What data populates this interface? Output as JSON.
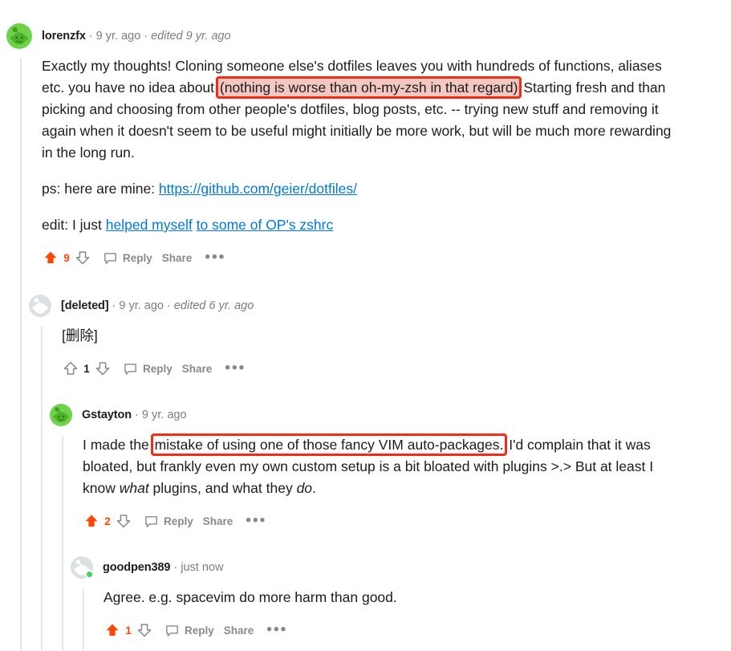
{
  "colors": {
    "upvote_active": "#ff4500",
    "vote_outline": "#878a8c",
    "link": "#0079d3",
    "annotation_border": "#f42a13",
    "annotation_fill": "#f3c8c3",
    "threadline": "#e4e6e7",
    "online_dot": "#46d160",
    "avatar_green": "#6fd24b",
    "avatar_gray": "#d7dbdd",
    "text": "#1c1c1c",
    "meta_text": "#7c7c7c",
    "action_text": "#878a8c"
  },
  "action_labels": {
    "reply": "Reply",
    "share": "Share",
    "more": "•••"
  },
  "comments": [
    {
      "id": "lorenzfx",
      "username": "lorenzfx",
      "timeago": "9 yr. ago",
      "edited": "edited 9 yr. ago",
      "avatar": "snoo-green-avatar",
      "online": false,
      "score": "9",
      "voted": true,
      "body": {
        "p1_before": "Exactly my thoughts! Cloning someone else's dotfiles leaves you with hundreds of functions, aliases etc. you have no idea about ",
        "p1_highlight": "(nothing is worse than oh-my-zsh in that regard)",
        "p1_after": " Starting fresh and than picking and choosing from other people's dotfiles, blog posts, etc. -- trying new stuff and removing it again when it doesn't seem to be useful might initially be more work, but will be much more rewarding in the long run.",
        "p2_before": "ps: here are mine: ",
        "p2_link": "https://github.com/geier/dotfiles/",
        "p3_before": "edit: I just ",
        "p3_link1": "helped myself",
        "p3_space": " ",
        "p3_link2": "to some of OP's zshrc"
      }
    },
    {
      "id": "deleted",
      "username": "[deleted]",
      "timeago": "9 yr. ago",
      "edited": "edited 6 yr. ago",
      "avatar": "snoo-gray-avatar",
      "online": false,
      "score": "1",
      "voted": false,
      "body": {
        "text": "[删除]"
      }
    },
    {
      "id": "gstayton",
      "username": "Gstayton",
      "timeago": "9 yr. ago",
      "edited": "",
      "avatar": "snoo-green-avatar",
      "online": false,
      "score": "2",
      "voted": true,
      "body": {
        "before": "I made the ",
        "highlight": "mistake of using one of those fancy VIM auto-packages.",
        "after_1": " I'd complain that it was bloated, but frankly even my own custom setup is a bit bloated with plugins >.> But at least I know ",
        "italic_1": "what",
        "after_2": " plugins, and what they ",
        "italic_2": "do",
        "after_3": "."
      }
    },
    {
      "id": "goodpen389",
      "username": "goodpen389",
      "timeago": "just now",
      "edited": "",
      "avatar": "snoo-gray-avatar",
      "online": true,
      "score": "1",
      "voted": true,
      "body": {
        "text": "Agree. e.g. spacevim do more harm than good."
      }
    }
  ]
}
